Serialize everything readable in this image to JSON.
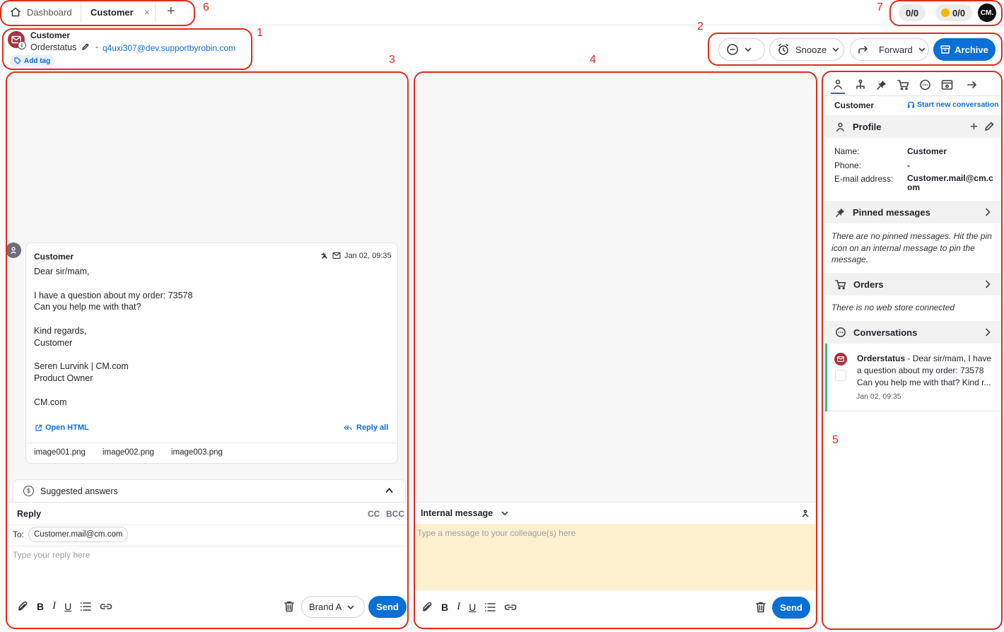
{
  "tabs": {
    "dashboard": "Dashboard",
    "customer": "Customer",
    "close": "×",
    "add": "+"
  },
  "counters": {
    "first": "0/0",
    "second": "0/0",
    "logo": "CM."
  },
  "header": {
    "name": "Customer",
    "subject": "Orderstatus",
    "separator": "-",
    "email": "q4uxi307@dev.supportbyrobin.com",
    "add_tag": "Add tag"
  },
  "actions": {
    "snooze": "Snooze",
    "forward": "Forward",
    "archive": "Archive"
  },
  "message": {
    "sender": "Customer",
    "time": "Jan 02, 09:35",
    "lines": [
      "Dear sir/mam,",
      "",
      "I have a question about my order: 73578",
      "Can you help me with that?",
      "",
      "Kind regards,",
      "Customer",
      "",
      "Seren Lurvink | CM.com",
      "Product Owner",
      "",
      "CM.com"
    ],
    "open_html": "Open HTML",
    "reply_all": "Reply all",
    "attachments": [
      "image001.png",
      "image002.png",
      "image003.png"
    ]
  },
  "suggested": "Suggested answers",
  "reply": {
    "title": "Reply",
    "cc": "CC",
    "bcc": "BCC",
    "to_label": "To:",
    "to_value": "Customer.mail@cm.com",
    "placeholder": "Type your reply here",
    "brand": "Brand A",
    "send": "Send"
  },
  "internal": {
    "title": "Internal message",
    "placeholder": "Type a message to your colleague(s) here",
    "send": "Send"
  },
  "side": {
    "header": "Customer",
    "start_new": "Start new conversation",
    "profile": {
      "title": "Profile",
      "name_label": "Name:",
      "name": "Customer",
      "phone_label": "Phone:",
      "phone": "-",
      "email_label": "E-mail address:",
      "email_l1": "Customer.mail@cm.c",
      "email_l2": "om"
    },
    "pinned": {
      "title": "Pinned messages",
      "l1": "There are no pinned messages. Hit the pin",
      "l2": "icon on an internal message to pin the",
      "l3": "message."
    },
    "orders": {
      "title": "Orders",
      "empty": "There is no web store connected"
    },
    "conversations": {
      "title": "Conversations",
      "subject": "Orderstatus",
      "l1": " - Dear sir/mam, I have",
      "l2": "a question about my order: 73578",
      "l3": "Can you help me with that? Kind r...",
      "time": "Jan 02, 09:35"
    }
  },
  "annotations": [
    "1",
    "2",
    "3",
    "4",
    "5",
    "6",
    "7"
  ],
  "colors": {
    "accent": "#0a6fd6",
    "annotation": "#e3291b",
    "internal_bg": "#fdf0cf",
    "email_icon": "#a63341",
    "conv_bar": "#2ec27e"
  }
}
